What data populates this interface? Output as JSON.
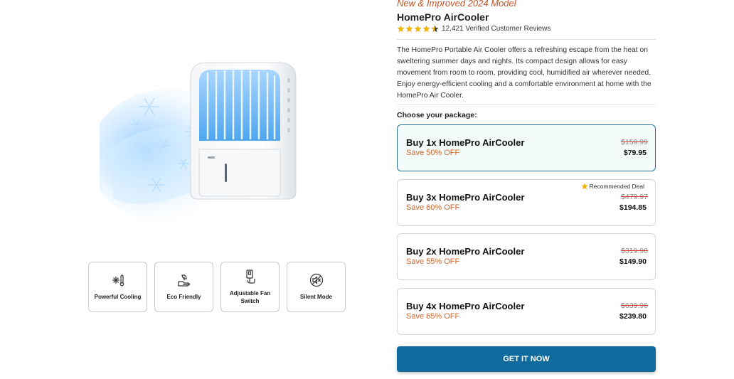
{
  "product": {
    "tagline": "New & Improved 2024 Model",
    "title": "HomePro AirCooler",
    "rating": 4.5,
    "reviews": "12,421 Verified Customer Reviews",
    "description": "The HomePro Portable Air Cooler offers a refreshing escape from the heat on sweltering summer days and nights. Its compact design allows for easy movement from room to room, providing cool, humidified air wherever needed. Enjoy energy-efficient cooling and a comfortable environment at home with the HomePro Air Cooler.",
    "choose_label": "Choose your package:"
  },
  "features": [
    {
      "label": "Powerful Cooling",
      "icon": "snowflake-thermometer-icon"
    },
    {
      "label": "Eco Friendly",
      "icon": "leaf-hand-icon"
    },
    {
      "label": "Adjustable Fan Switch",
      "icon": "switch-hand-icon"
    },
    {
      "label": "Silent Mode",
      "icon": "mute-icon"
    }
  ],
  "packages": [
    {
      "name": "Buy 1x HomePro AirCooler",
      "save": "Save 50% OFF",
      "old_price": "$159.99",
      "new_price": "$79.95",
      "selected": true
    },
    {
      "name": "Buy 3x HomePro AirCooler",
      "save": "Save 60% OFF",
      "old_price": "$479.97",
      "new_price": "$194.85",
      "badge": "Recommended Deal"
    },
    {
      "name": "Buy 2x HomePro AirCooler",
      "save": "Save 55% OFF",
      "old_price": "$319.98",
      "new_price": "$149.90"
    },
    {
      "name": "Buy 4x HomePro AirCooler",
      "save": "Save 65% OFF",
      "old_price": "$639.96",
      "new_price": "$239.80"
    }
  ],
  "cta": {
    "label": "GET IT NOW"
  },
  "colors": {
    "accent": "#0f6b9e",
    "save": "#d0672c",
    "tagline": "#c0552a",
    "star": "#f5b301"
  }
}
